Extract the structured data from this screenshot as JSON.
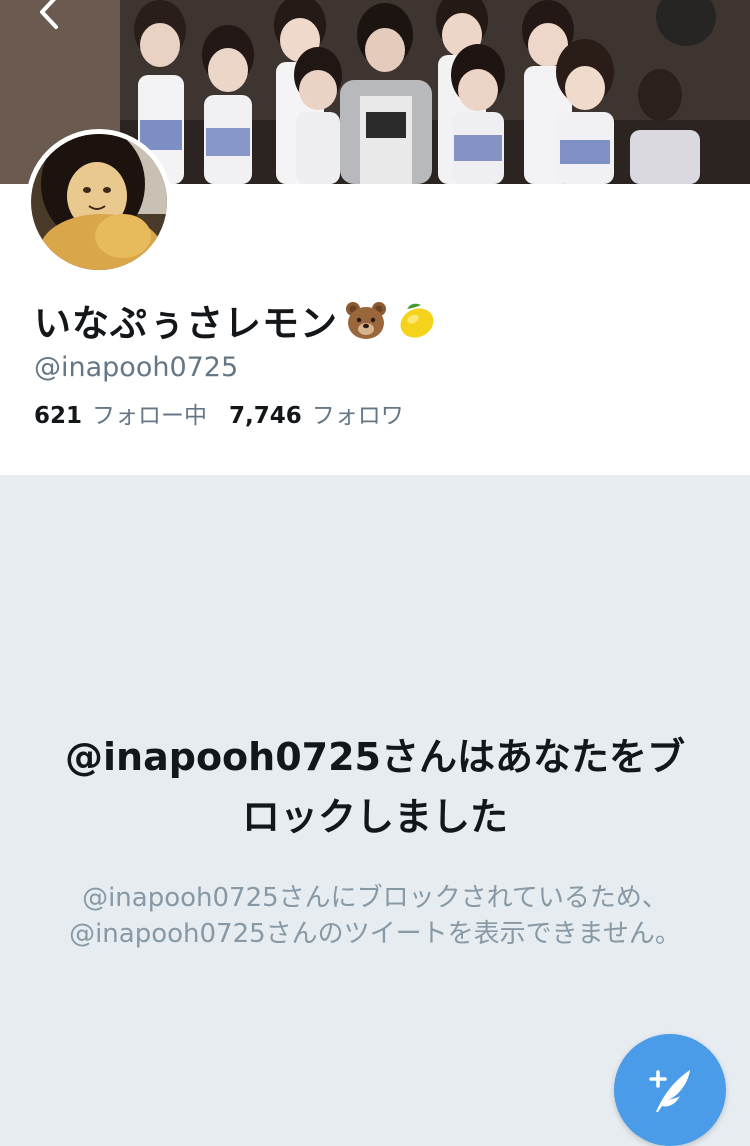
{
  "header": {
    "back_icon": "chevron-left-icon",
    "more_icon": "more-options-icon"
  },
  "profile": {
    "display_name": "いなぷぅさレモン",
    "name_emojis": [
      "bear-face-emoji",
      "lemon-emoji"
    ],
    "handle": "@inapooh0725",
    "following": {
      "count": "621",
      "label": "フォロー中"
    },
    "followers": {
      "count": "7,746",
      "label": "フォロワ"
    }
  },
  "blocked": {
    "title": "@inapooh0725さんはあなたをブロックしました",
    "body": "@inapooh0725さんにブロックされているため、@inapooh0725さんのツイートを表示できません。"
  },
  "fab": {
    "icon": "compose-tweet-icon"
  },
  "colors": {
    "accent": "#4a9be8",
    "background": "#e6ecf0",
    "secondary_text": "#657786",
    "muted_text": "#8899a6"
  }
}
